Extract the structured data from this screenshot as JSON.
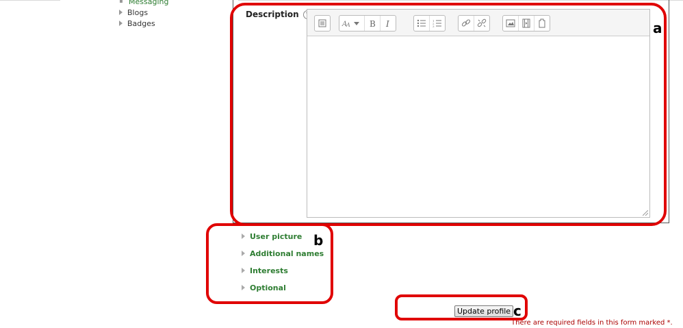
{
  "sidebar": {
    "items": [
      {
        "label": "Messaging",
        "style": "current"
      },
      {
        "label": "Blogs",
        "style": "collapsed"
      },
      {
        "label": "Badges",
        "style": "collapsed"
      }
    ]
  },
  "form": {
    "description_label": "Description",
    "help_glyph": "?",
    "toolbar_icons": [
      "show-more-icon",
      "font-style-icon",
      "bold-icon",
      "italic-icon",
      "unordered-list-icon",
      "ordered-list-icon",
      "link-icon",
      "unlink-icon",
      "image-icon",
      "media-icon",
      "manage-files-icon"
    ],
    "sections": [
      "User picture",
      "Additional names",
      "Interests",
      "Optional"
    ],
    "submit_label": "Update profile",
    "required_note": "There are required fields in this form marked",
    "required_marker": "*."
  },
  "annotations": {
    "a": "a",
    "b": "b",
    "c": "c",
    "color": "#e00000"
  }
}
